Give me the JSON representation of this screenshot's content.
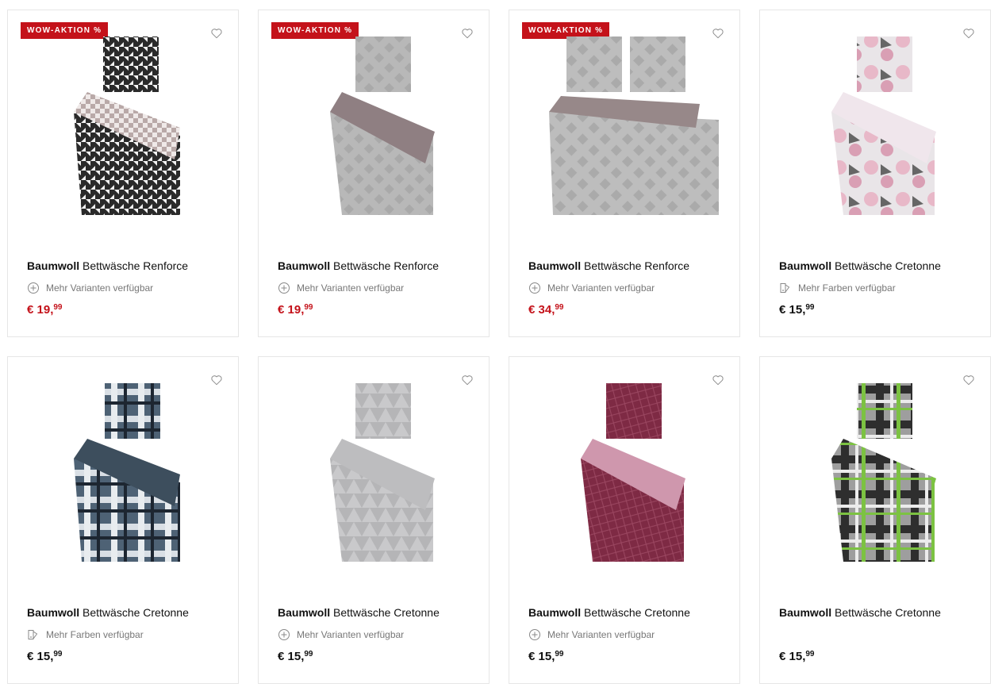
{
  "colors": {
    "sale_red": "#c4121a",
    "text": "#111111",
    "muted": "#777777",
    "border": "#e6e6e6"
  },
  "products": [
    {
      "badge": "WOW-AKTION %",
      "brand": "Baumwoll",
      "name": "Bettwäsche Renforce",
      "availability": "Mehr Varianten verfügbar",
      "availability_icon": "plus-circle-icon",
      "price_main": "€ 19,",
      "price_cents": "99",
      "sale": true,
      "image": "houndstooth bedding set, black and white"
    },
    {
      "badge": "WOW-AKTION %",
      "brand": "Baumwoll",
      "name": "Bettwäsche Renforce",
      "availability": "Mehr Varianten verfügbar",
      "availability_icon": "plus-circle-icon",
      "price_main": "€ 19,",
      "price_cents": "99",
      "sale": true,
      "image": "grey patterned bedding set with taupe reverse"
    },
    {
      "badge": "WOW-AKTION %",
      "brand": "Baumwoll",
      "name": "Bettwäsche Renforce",
      "availability": "Mehr Varianten verfügbar",
      "availability_icon": "plus-circle-icon",
      "price_main": "€ 34,",
      "price_cents": "99",
      "sale": true,
      "image": "large grey bedding set with two pillows"
    },
    {
      "badge": "",
      "brand": "Baumwoll",
      "name": "Bettwäsche Cretonne",
      "availability": "Mehr Farben verfügbar",
      "availability_icon": "color-swatch-icon",
      "price_main": "€ 15,",
      "price_cents": "99",
      "sale": false,
      "image": "pink floral hibiscus bedding set"
    },
    {
      "badge": "",
      "brand": "Baumwoll",
      "name": "Bettwäsche Cretonne",
      "availability": "Mehr Farben verfügbar",
      "availability_icon": "color-swatch-icon",
      "price_main": "€ 15,",
      "price_cents": "99",
      "sale": false,
      "image": "blue plaid bedding set"
    },
    {
      "badge": "",
      "brand": "Baumwoll",
      "name": "Bettwäsche Cretonne",
      "availability": "Mehr Varianten verfügbar",
      "availability_icon": "plus-circle-icon",
      "price_main": "€ 15,",
      "price_cents": "99",
      "sale": false,
      "image": "grey triangle pattern bedding set"
    },
    {
      "badge": "",
      "brand": "Baumwoll",
      "name": "Bettwäsche Cretonne",
      "availability": "Mehr Varianten verfügbar",
      "availability_icon": "plus-circle-icon",
      "price_main": "€ 15,",
      "price_cents": "99",
      "sale": false,
      "image": "burgundy bedding set with pink reverse"
    },
    {
      "badge": "",
      "brand": "Baumwoll",
      "name": "Bettwäsche Cretonne",
      "availability": "",
      "availability_icon": "",
      "price_main": "€ 15,",
      "price_cents": "99",
      "sale": false,
      "image": "grey and green plaid bedding set"
    }
  ]
}
